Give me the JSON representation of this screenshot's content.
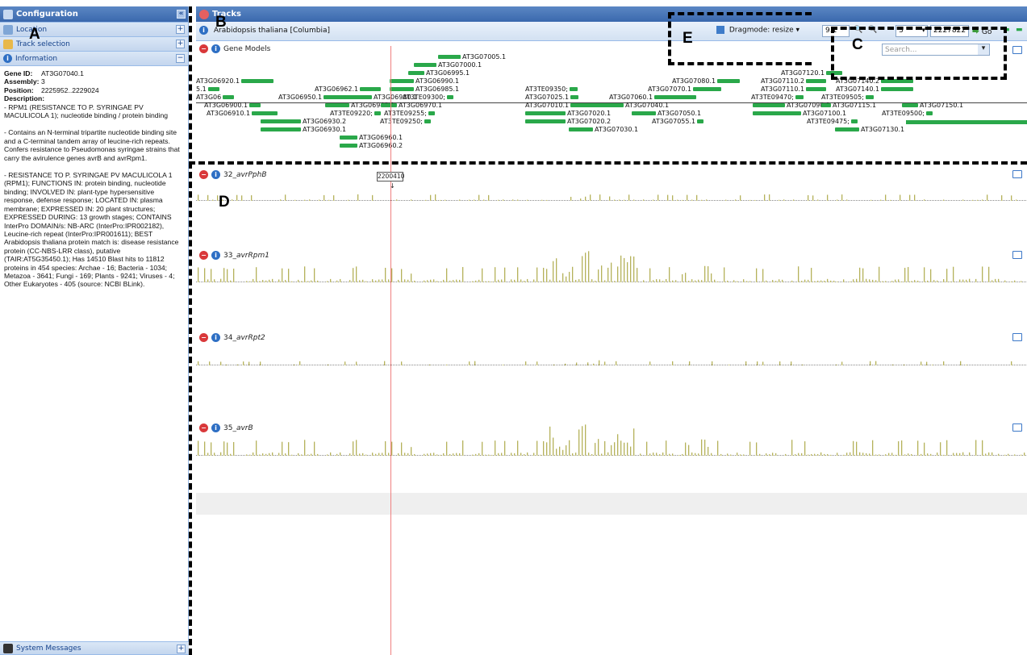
{
  "left_panel": {
    "title": "Configuration",
    "sections": [
      {
        "label": "Location",
        "icon": "location-icon"
      },
      {
        "label": "Track selection",
        "icon": "box-icon"
      },
      {
        "label": "Information",
        "icon": "info-icon"
      }
    ],
    "info": {
      "gene_id_key": "Gene ID:",
      "gene_id": "AT3G07040.1",
      "assembly_key": "Assembly:",
      "assembly": "3",
      "position_key": "Position:",
      "position": "2225952..2229024",
      "description_key": "Description:",
      "para1": "- RPM1 (RESISTANCE TO P. SYRINGAE PV MACULICOLA 1); nucleotide binding / protein binding",
      "para2": "- Contains an N-terminal tripartite nucleotide binding site and a C-terminal tandem array of leucine-rich repeats. Confers resistance to Pseudomonas syringae strains that carry the avirulence genes avrB and avrRpm1.",
      "para3": "- RESISTANCE TO P. SYRINGAE PV MACULICOLA 1 (RPM1); FUNCTIONS IN: protein binding, nucleotide binding; INVOLVED IN: plant-type hypersensitive response, defense response; LOCATED IN: plasma membrane; EXPRESSED IN: 20 plant structures; EXPRESSED DURING: 13 growth stages; CONTAINS InterPro DOMAIN/s: NB-ARC (InterPro:IPR002182), Leucine-rich repeat (InterPro:IPR001611); BEST Arabidopsis thaliana protein match is: disease resistance protein (CC-NBS-LRR class), putative (TAIR:AT5G35450.1); Has 14510 Blast hits to 11812 proteins in 454 species: Archae - 16; Bacteria - 1034; Metazoa - 3641; Fungi - 169; Plants - 9241; Viruses - 4; Other Eukaryotes - 405 (source: NCBI BLink)."
    },
    "system_messages": "System Messages"
  },
  "right_panel": {
    "title": "Tracks",
    "organism": "Arabidopsis thaliana [Columbia]",
    "dragmode": "Dragmode: resize",
    "zoom_value": "9.1",
    "chromosome": "3",
    "position_value": "2227822",
    "go_label": "Go",
    "search_placeholder": "Search...",
    "coord_marker": "2200410"
  },
  "tracks": [
    {
      "id": "gene-models",
      "label": "Gene Models",
      "italic": ""
    },
    {
      "id": "t32",
      "label": "32_",
      "italic": "avrPphB"
    },
    {
      "id": "t33",
      "label": "33_",
      "italic": "avrRpm1"
    },
    {
      "id": "t34",
      "label": "34_",
      "italic": "avrRpt2"
    },
    {
      "id": "t35",
      "label": "35_",
      "italic": "avrB"
    }
  ],
  "genes": [
    "AT3G07005.1",
    "AT3G07000.1",
    "AT3G06995.1",
    "AT3G06920.1",
    "AT3G06990.1",
    "AT3G06985.1",
    "AT3G06962.1",
    "AT3G06950.1",
    "AT3G06980.1",
    "AT3TE09300;",
    "AT3G06900.1",
    "AT3G06940.1",
    "AT3G06970.1",
    "AT3G06910.1",
    "AT3TE09220;",
    "AT3TE09255;",
    "AT3G06930.2",
    "AT3TE09250;",
    "AT3G06930.1",
    "AT3G06960.1",
    "AT3G06960.2",
    "AT3TE09350;",
    "AT3G07025.1",
    "AT3G07060.1",
    "AT3G07070.1",
    "AT3G07080.1",
    "AT3G07010.1",
    "AT3G07040.1",
    "AT3G07050.1",
    "AT3G07020.1",
    "AT3G07020.2",
    "AT3G07055.1",
    "AT3G07030.1",
    "AT3G07120.1",
    "AT3G07110.2",
    "AT3G07140.2",
    "AT3G07110.1",
    "AT3G07140.1",
    "AT3TE09470;",
    "AT3TE09505;",
    "AT3G07090.1",
    "AT3G07115.1",
    "AT3G07150.1",
    "AT3G07100.1",
    "AT3TE09500;",
    "AT3TE09475;",
    "AT3G07130.1",
    "5.1",
    "AT3G06"
  ],
  "annotations": [
    "A",
    "B",
    "C",
    "D",
    "E"
  ],
  "colors": {
    "header_blue": "#3a68ad",
    "gene_green": "#2aa84a",
    "bar_olive": "#b5b15a",
    "marker_red": "#f08080"
  }
}
